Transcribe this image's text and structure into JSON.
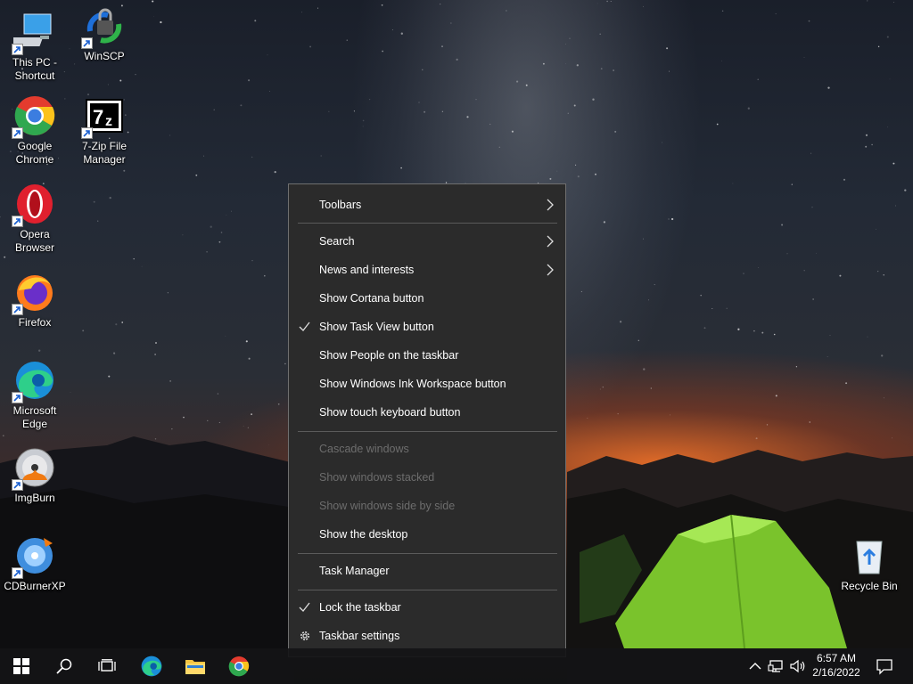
{
  "desktop": {
    "icons": [
      {
        "label1": "This PC -",
        "label2": "Shortcut",
        "icon": "computer-icon"
      },
      {
        "label1": "WinSCP",
        "label2": "",
        "icon": "winscp-icon"
      },
      {
        "label1": "Google",
        "label2": "Chrome",
        "icon": "chrome-icon"
      },
      {
        "label1": "7-Zip File",
        "label2": "Manager",
        "icon": "7zip-icon"
      },
      {
        "label1": "Opera",
        "label2": "Browser",
        "icon": "opera-icon"
      },
      {
        "label1": "Firefox",
        "label2": "",
        "icon": "firefox-icon"
      },
      {
        "label1": "Microsoft",
        "label2": "Edge",
        "icon": "edge-icon"
      },
      {
        "label1": "ImgBurn",
        "label2": "",
        "icon": "imgburn-icon"
      },
      {
        "label1": "CDBurnerXP",
        "label2": "",
        "icon": "cdburnerxp-icon"
      },
      {
        "label1": "Recycle Bin",
        "label2": "",
        "icon": "recycle-bin-icon"
      }
    ]
  },
  "context_menu": {
    "items": [
      {
        "label": "Toolbars",
        "submenu": true
      },
      {
        "label": "Search",
        "submenu": true
      },
      {
        "label": "News and interests",
        "submenu": true
      },
      {
        "label": "Show Cortana button"
      },
      {
        "label": "Show Task View button",
        "checked": true
      },
      {
        "label": "Show People on the taskbar"
      },
      {
        "label": "Show Windows Ink Workspace button"
      },
      {
        "label": "Show touch keyboard button"
      },
      {
        "label": "Cascade windows",
        "disabled": true
      },
      {
        "label": "Show windows stacked",
        "disabled": true
      },
      {
        "label": "Show windows side by side",
        "disabled": true
      },
      {
        "label": "Show the desktop"
      },
      {
        "label": "Task Manager"
      },
      {
        "label": "Lock the taskbar",
        "checked": true
      },
      {
        "label": "Taskbar settings",
        "icon": "gear-icon"
      }
    ]
  },
  "taskbar": {
    "buttons": [
      "start-icon",
      "search-icon",
      "task-view-icon",
      "edge-icon",
      "file-explorer-icon",
      "chrome-icon"
    ],
    "tray": [
      "chevron-up-icon",
      "network-icon",
      "volume-icon",
      "notifications-icon"
    ],
    "time": "6:57 AM",
    "date": "2/16/2022"
  },
  "colors": {
    "menu_bg": "#2b2b2b",
    "menu_border": "#6f6f6f",
    "disabled_text": "#6d6d6d",
    "taskbar_bg": "#141416"
  }
}
